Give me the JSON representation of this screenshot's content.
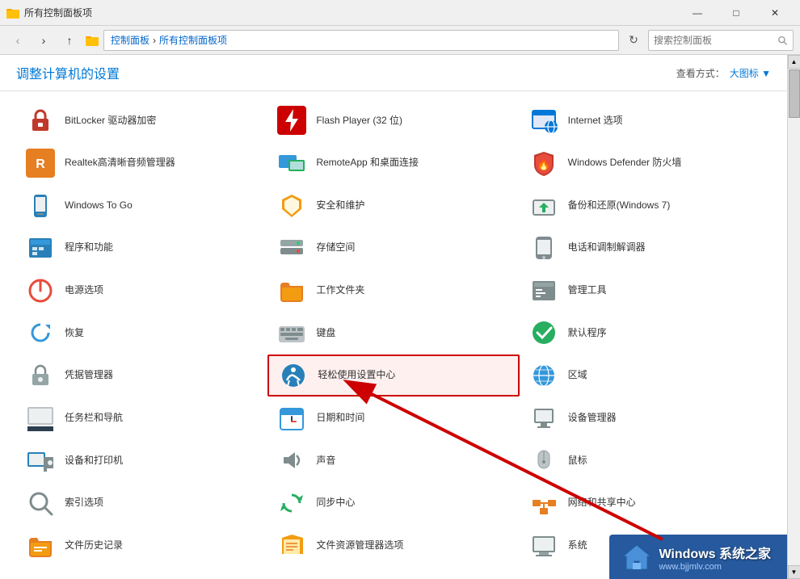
{
  "titlebar": {
    "title": "所有控制面板项",
    "minimize": "—",
    "maximize": "□",
    "close": "✕"
  },
  "addressbar": {
    "back": "‹",
    "forward": "›",
    "up": "↑",
    "breadcrumb": [
      "控制面板",
      "所有控制面板项"
    ],
    "separator": "›",
    "refresh": "↻",
    "search_placeholder": "搜索控制面板"
  },
  "header": {
    "title": "调整计算机的设置",
    "view_label": "查看方式：",
    "view_current": "大图标",
    "view_arrow": "▼"
  },
  "items": [
    {
      "id": "bitlocker",
      "label": "BitLocker 驱动器加密",
      "icon": "🔑",
      "col": 0
    },
    {
      "id": "flash",
      "label": "Flash Player (32 位)",
      "icon": "⚡",
      "col": 1
    },
    {
      "id": "internet",
      "label": "Internet 选项",
      "icon": "🌐",
      "col": 2
    },
    {
      "id": "realtek",
      "label": "Realtek高清晰音频管理器",
      "icon": "🔊",
      "col": 0
    },
    {
      "id": "remoteapp",
      "label": "RemoteApp 和桌面连接",
      "icon": "🖥",
      "col": 1
    },
    {
      "id": "defender",
      "label": "Windows Defender 防火墙",
      "icon": "🛡",
      "col": 2
    },
    {
      "id": "wintogo",
      "label": "Windows To Go",
      "icon": "💾",
      "col": 0
    },
    {
      "id": "security",
      "label": "安全和维护",
      "icon": "🚩",
      "col": 1
    },
    {
      "id": "backup",
      "label": "备份和还原(Windows 7)",
      "icon": "🔄",
      "col": 2
    },
    {
      "id": "program",
      "label": "程序和功能",
      "icon": "📋",
      "col": 0
    },
    {
      "id": "storage",
      "label": "存储空间",
      "icon": "🗄",
      "col": 1
    },
    {
      "id": "phone",
      "label": "电话和调制解调器",
      "icon": "📞",
      "col": 2
    },
    {
      "id": "power",
      "label": "电源选项",
      "icon": "⚡",
      "col": 0
    },
    {
      "id": "workfolder",
      "label": "工作文件夹",
      "icon": "📁",
      "col": 1
    },
    {
      "id": "manage",
      "label": "管理工具",
      "icon": "🔧",
      "col": 2
    },
    {
      "id": "restore",
      "label": "恢复",
      "icon": "🔁",
      "col": 0
    },
    {
      "id": "keyboard",
      "label": "键盘",
      "icon": "⌨",
      "col": 1
    },
    {
      "id": "default",
      "label": "默认程序",
      "icon": "✅",
      "col": 2
    },
    {
      "id": "credential",
      "label": "凭据管理器",
      "icon": "🔐",
      "col": 0
    },
    {
      "id": "easyaccess",
      "label": "轻松使用设置中心",
      "icon": "♿",
      "col": 1,
      "highlighted": true
    },
    {
      "id": "region",
      "label": "区域",
      "icon": "🌍",
      "col": 2
    },
    {
      "id": "taskbar",
      "label": "任务栏和导航",
      "icon": "🖥",
      "col": 0
    },
    {
      "id": "datetime",
      "label": "日期和时间",
      "icon": "🗓",
      "col": 1
    },
    {
      "id": "devicemgr",
      "label": "设备管理器",
      "icon": "🖨",
      "col": 2
    },
    {
      "id": "device",
      "label": "设备和打印机",
      "icon": "🖨",
      "col": 0
    },
    {
      "id": "sound",
      "label": "声音",
      "icon": "🔈",
      "col": 1
    },
    {
      "id": "mouse",
      "label": "鼠标",
      "icon": "🖱",
      "col": 2
    },
    {
      "id": "index",
      "label": "索引选项",
      "icon": "🔍",
      "col": 0
    },
    {
      "id": "sync",
      "label": "同步中心",
      "icon": "🔃",
      "col": 1
    },
    {
      "id": "network",
      "label": "网络和共享中心",
      "icon": "🌐",
      "col": 2
    },
    {
      "id": "filehistory",
      "label": "文件历史记录",
      "icon": "📂",
      "col": 0
    },
    {
      "id": "fileoption",
      "label": "文件资源管理器选项",
      "icon": "📁",
      "col": 1
    },
    {
      "id": "system",
      "label": "系统",
      "icon": "💻",
      "col": 2
    }
  ],
  "watermark": {
    "title": "Windows 系统之家",
    "url": "www.bjjmlv.com"
  }
}
